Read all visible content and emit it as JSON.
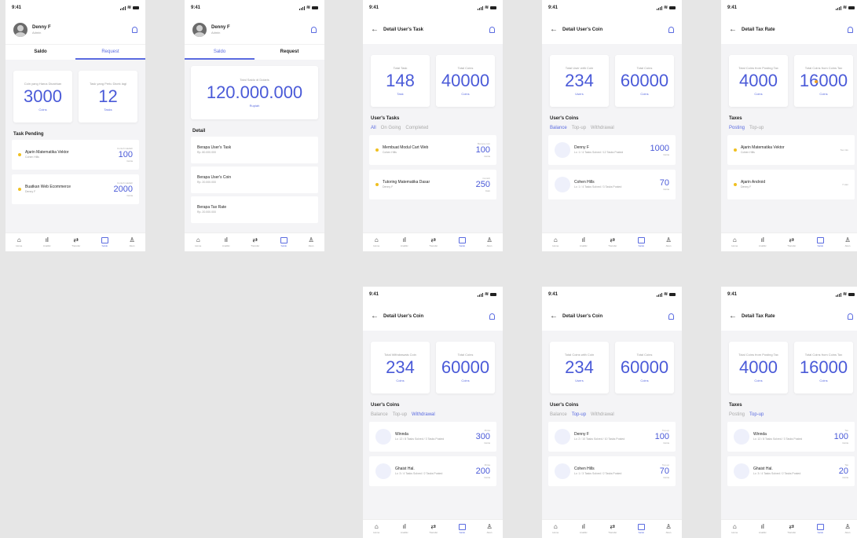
{
  "status_time": "9:41",
  "nav": [
    {
      "icon": "home-icon",
      "glyph": "⌂",
      "label": "Home"
    },
    {
      "icon": "chart-icon",
      "glyph": "ıl",
      "label": "Analitic"
    },
    {
      "icon": "transfer-icon",
      "glyph": "⇄",
      "label": "Transfer"
    },
    {
      "icon": "wallet-icon",
      "glyph": "",
      "label": "Saldo"
    },
    {
      "icon": "user-icon",
      "glyph": "♙",
      "label": "Akun"
    }
  ],
  "colors": {
    "accent": "#5a6be0",
    "dot": "#f0c020"
  },
  "screens": {
    "s1": {
      "user_name": "Denny F",
      "user_role": "Admin",
      "tab_left": "Saldo",
      "tab_right": "Request",
      "stats": [
        {
          "label": "Coin yang Harus Dicairkan",
          "value": "3000",
          "unit": "Coins"
        },
        {
          "label": "Task yang Perlu Dicek lagi",
          "value": "12",
          "unit": "Tasks"
        }
      ],
      "section": "Task Pending",
      "items": [
        {
          "title": "Ajarin Matematika Vektor",
          "sub": "Cohen Hills",
          "cap": "Contoh Hadiah",
          "value": "100",
          "unit": "Coins"
        },
        {
          "title": "Buatkan Web Ecommerce",
          "sub": "Denny F",
          "cap": "Contoh Hadiah",
          "value": "2000",
          "unit": "Coins"
        }
      ]
    },
    "s2": {
      "user_name": "Denny F",
      "user_role": "Admin",
      "tab_left": "Saldo",
      "tab_right": "Request",
      "total_label": "Total Saldo di Dolaris",
      "total_value": "120.000.000",
      "total_unit": "Rupiah",
      "section": "Detail",
      "items": [
        {
          "title": "Berapa User's Task",
          "sub": "Rp. 80.000.000"
        },
        {
          "title": "Berapa User's Coin",
          "sub": "Rp. 20.000.000"
        },
        {
          "title": "Berapa Tax Rate",
          "sub": "Rp. 20.000.000"
        }
      ]
    },
    "s3": {
      "title": "Detail User's Task",
      "stats": [
        {
          "label": "Total Task",
          "value": "148",
          "unit": "Task"
        },
        {
          "label": "Total Coins",
          "value": "40000",
          "unit": "Coins"
        }
      ],
      "section": "User's Tasks",
      "filters": [
        "All",
        "On Going",
        "Completed"
      ],
      "items": [
        {
          "title": "Membuat Modul Cart Web",
          "sub": "Cohen Hills",
          "cap": "Berupa coin",
          "value": "100",
          "unit": "Coins"
        },
        {
          "title": "Tutoring Matematika Dasar",
          "sub": "Denny F",
          "cap": "Contoh",
          "value": "250",
          "unit": "Coin"
        }
      ]
    },
    "s4": {
      "title": "Detail User's Coin",
      "stats": [
        {
          "label": "Total User with Coin",
          "value": "234",
          "unit": "Users"
        },
        {
          "label": "Total Coins",
          "value": "60000",
          "unit": "Coins"
        }
      ],
      "section": "User's Coins",
      "filters": [
        "Balance",
        "Top-up",
        "Withdrawal"
      ],
      "items": [
        {
          "title": "Denny F",
          "sub": "Lv. 1 / 4 Tasks Solved / 12 Tasks Posted",
          "value": "1000",
          "unit": "Coins"
        },
        {
          "title": "Cohen Hills",
          "sub": "Lv. 1 / 4 Tasks Solved / 3 Tasks Posted",
          "value": "70",
          "unit": "Coins"
        }
      ]
    },
    "s5": {
      "title": "Detail Tax Rate",
      "stats": [
        {
          "label": "Total Coins from Posting Tax",
          "value": "4000",
          "unit": "Coins"
        },
        {
          "label": "Total Coins from Coins Tax",
          "value": "16000",
          "unit": "Coins"
        }
      ],
      "section": "Taxes",
      "filters": [
        "Posting",
        "Top-up"
      ],
      "items": [
        {
          "title": "Ajarin Matematika Vektor",
          "sub": "Cohen Hills",
          "cap": "Tax info"
        },
        {
          "title": "Ajarin Android",
          "sub": "Denny F",
          "cap": "7 Hari"
        }
      ]
    },
    "s6": {
      "title": "Detail User's Coin",
      "stats": [
        {
          "label": "Total Withdrawals Coin",
          "value": "234",
          "unit": "Coins"
        },
        {
          "label": "Total Coins",
          "value": "60000",
          "unit": "Coins"
        }
      ],
      "section": "User's Coins",
      "filters": [
        "Balance",
        "Top-up",
        "Withdrawal"
      ],
      "items": [
        {
          "title": "Winnda",
          "sub": "Lv. 12 / 8 Tasks Solved / 3 Tasks Posted",
          "cap": "Minta",
          "value": "300",
          "unit": "Coins"
        },
        {
          "title": "Ghaist Hal.",
          "sub": "Lv. 3 / 4 Tasks Solved / 2 Tasks Posted",
          "cap": "Minta",
          "value": "200",
          "unit": "Coins"
        }
      ]
    },
    "s7": {
      "title": "Detail User's Coin",
      "stats": [
        {
          "label": "Total Coins with Coin",
          "value": "234",
          "unit": "Users"
        },
        {
          "label": "Total Coins",
          "value": "60000",
          "unit": "Coins"
        }
      ],
      "section": "User's Coins",
      "filters": [
        "Balance",
        "Top-up",
        "Withdrawal"
      ],
      "items": [
        {
          "title": "Denny F",
          "sub": "Lv. 2 / 10 Tasks Solved / 10 Tasks Posted",
          "cap": "Top-up",
          "value": "100",
          "unit": "Coins"
        },
        {
          "title": "Cohen Hills",
          "sub": "Lv. 1 / 3 Tasks Solved / 2 Tasks Posted",
          "cap": "Top-up",
          "value": "70",
          "unit": "Coins"
        }
      ]
    },
    "s8": {
      "title": "Detail Tax Rate",
      "stats": [
        {
          "label": "Total Coins from Posting Tax",
          "value": "4000",
          "unit": "Coins"
        },
        {
          "label": "Total Coins from Coins Tax",
          "value": "16000",
          "unit": "Coins"
        }
      ],
      "section": "Taxes",
      "filters": [
        "Posting",
        "Top-up"
      ],
      "items": [
        {
          "title": "Winnda",
          "sub": "Lv. 12 / 8 Tasks Solved / 3 Tasks Posted",
          "cap": "Tax",
          "value": "100",
          "unit": "Coins"
        },
        {
          "title": "Ghaist Hal.",
          "sub": "Lv. 3 / 4 Tasks Solved / 2 Tasks Posted",
          "cap": "Tax",
          "value": "20",
          "unit": "Coins"
        }
      ]
    }
  }
}
